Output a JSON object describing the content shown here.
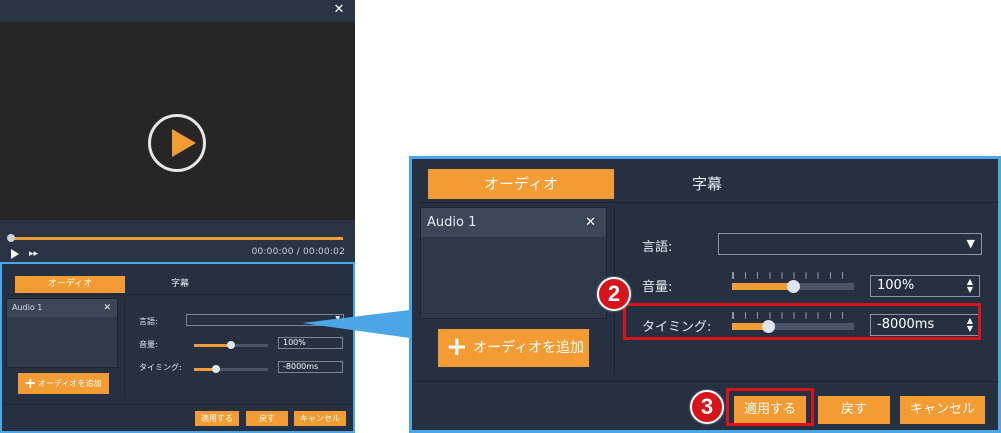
{
  "colors": {
    "accent": "#f39c34",
    "panel_bg": "#263041",
    "highlight_border": "#4ba6e6",
    "annotation_red": "#d8131a"
  },
  "window": {
    "close_icon": "close-icon",
    "close_glyph": "✕",
    "time_display": "00:00:00 / 00:00:02",
    "seek_progress": 1.0
  },
  "panel": {
    "tabs": [
      {
        "label": "オーディオ",
        "active": true
      },
      {
        "label": "字幕",
        "active": false
      }
    ],
    "audio_list": [
      {
        "label": "Audio 1"
      }
    ],
    "remove_glyph": "✕",
    "add_audio_label": "オーディオを追加",
    "add_glyph": "+",
    "language_label": "言語:",
    "language_value": "",
    "volume_label": "音量:",
    "volume_value": "100%",
    "volume_level": 0.5,
    "timing_label": "タイミング:",
    "timing_value": "-8000ms",
    "timing_level": 0.3,
    "dropdown_glyph": "▼",
    "spin_up": "▲",
    "spin_down": "▼",
    "buttons": {
      "apply": "適用する",
      "back": "戻す",
      "cancel": "キャンセル"
    }
  },
  "annotations": {
    "step2": "2",
    "step3": "3"
  }
}
